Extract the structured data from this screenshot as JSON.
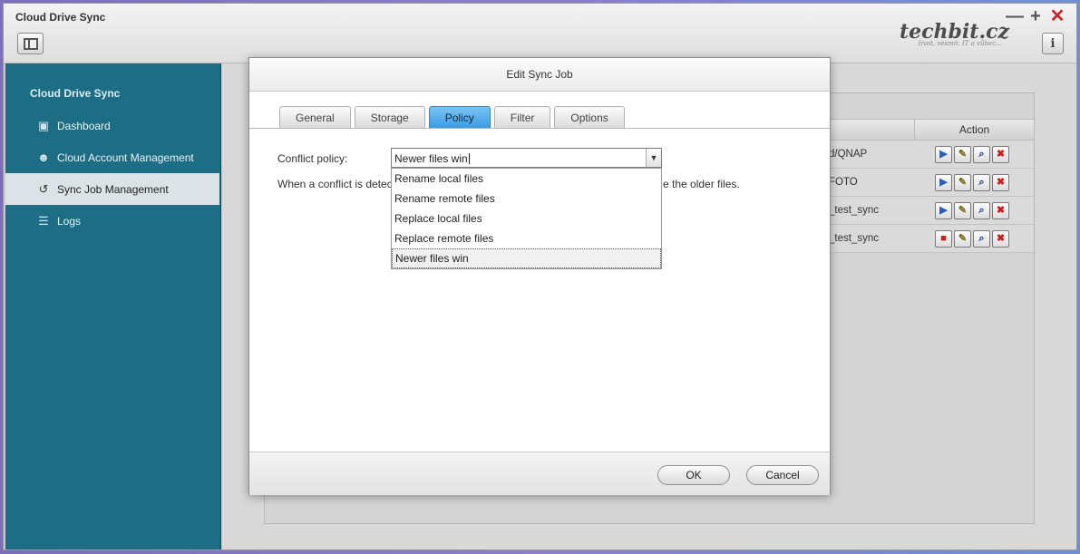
{
  "app": {
    "title": "Cloud Drive Sync",
    "brand": "techbit.cz",
    "brand_tagline": "život, vesmír, IT a vůbec...",
    "win_min": "—",
    "win_max": "+",
    "win_close": "✕",
    "info": "i"
  },
  "sidebar": {
    "title": "Cloud Drive Sync",
    "items": [
      {
        "label": "Dashboard",
        "icon": "monitor-icon",
        "glyph": "▣"
      },
      {
        "label": "Cloud Account Management",
        "icon": "user-icon",
        "glyph": "☻"
      },
      {
        "label": "Sync Job Management",
        "icon": "history-icon",
        "glyph": "↺",
        "active": true
      },
      {
        "label": "Logs",
        "icon": "log-icon",
        "glyph": "☰"
      }
    ]
  },
  "jobs": {
    "action_header": "Action",
    "rows": [
      {
        "path": "d/QNAP",
        "state": "play"
      },
      {
        "path": "FOTO",
        "state": "play"
      },
      {
        "path": "_test_sync",
        "state": "play"
      },
      {
        "path": "_test_sync",
        "state": "stop"
      }
    ],
    "glyphs": {
      "play": "▶",
      "stop": "■",
      "edit": "✎",
      "view": "⌕",
      "delete": "✖"
    }
  },
  "dialog": {
    "title": "Edit Sync Job",
    "tabs": [
      "General",
      "Storage",
      "Policy",
      "Filter",
      "Options"
    ],
    "active_tab": "Policy",
    "conflict_label": "Conflict policy:",
    "conflict_value": "Newer files win",
    "description_start": "When a conflict is detec",
    "description_end": "e the older files.",
    "options": [
      "Rename local files",
      "Rename remote files",
      "Replace local files",
      "Replace remote files",
      "Newer files win"
    ],
    "selected_option": "Newer files win",
    "ok_label": "OK",
    "cancel_label": "Cancel",
    "arrow": "⌵"
  },
  "colors": {
    "sidebar_bg": "#1d6e84",
    "active_tab": "#3a9ce0",
    "close_red": "#c8262a"
  }
}
